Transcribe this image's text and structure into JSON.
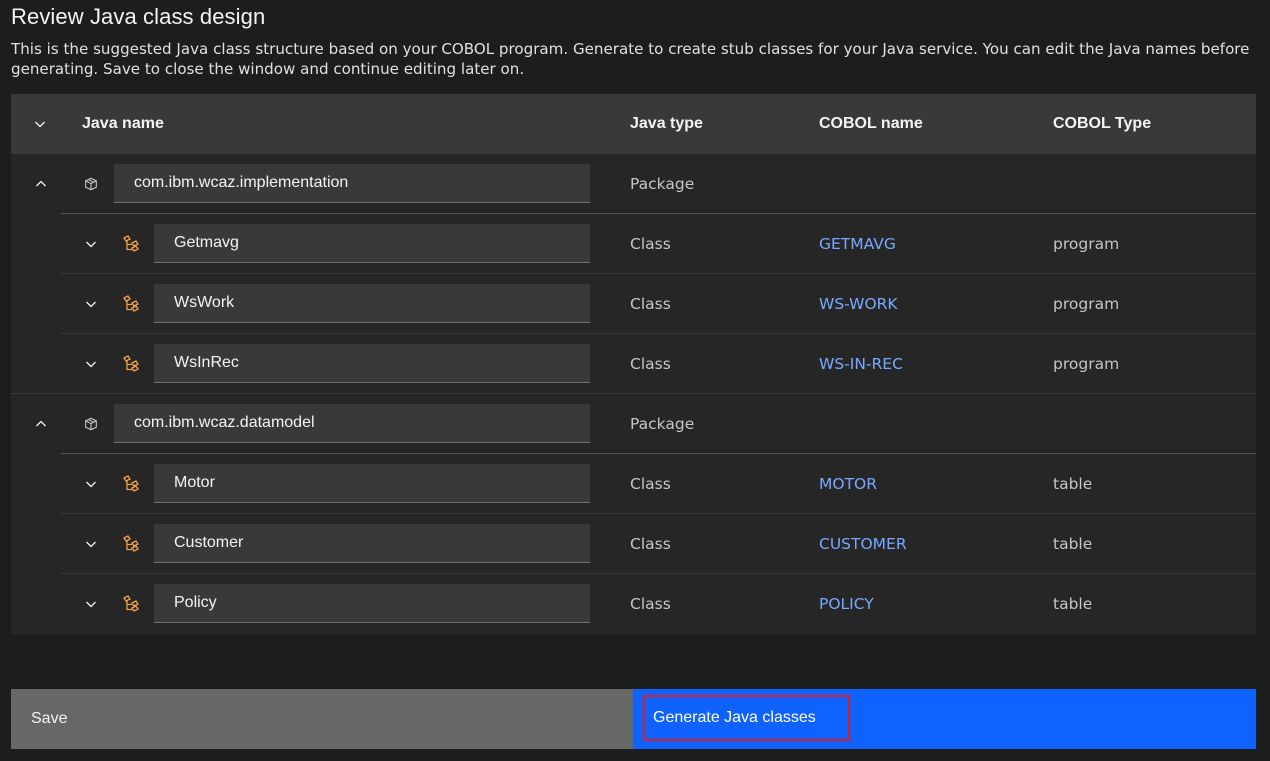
{
  "page": {
    "title": "Review Java class design",
    "description": "This is the suggested Java class structure based on your COBOL program. Generate to create stub classes for your Java service. You can edit the Java names before generating. Save to close the window and continue editing later on."
  },
  "table": {
    "headers": {
      "java_name": "Java name",
      "java_type": "Java type",
      "cobol_name": "COBOL name",
      "cobol_type": "COBOL Type"
    },
    "groups": [
      {
        "package": "com.ibm.wcaz.implementation",
        "type": "Package",
        "expanded": true,
        "classes": [
          {
            "name": "Getmavg",
            "type": "Class",
            "cobol_name": "GETMAVG",
            "cobol_type": "program"
          },
          {
            "name": "WsWork",
            "type": "Class",
            "cobol_name": "WS-WORK",
            "cobol_type": "program"
          },
          {
            "name": "WsInRec",
            "type": "Class",
            "cobol_name": "WS-IN-REC",
            "cobol_type": "program"
          }
        ]
      },
      {
        "package": "com.ibm.wcaz.datamodel",
        "type": "Package",
        "expanded": true,
        "classes": [
          {
            "name": "Motor",
            "type": "Class",
            "cobol_name": "MOTOR",
            "cobol_type": "table"
          },
          {
            "name": "Customer",
            "type": "Class",
            "cobol_name": "CUSTOMER",
            "cobol_type": "table"
          },
          {
            "name": "Policy",
            "type": "Class",
            "cobol_name": "POLICY",
            "cobol_type": "table"
          }
        ]
      }
    ]
  },
  "footer": {
    "save_label": "Save",
    "generate_label": "Generate Java classes"
  },
  "icons": {
    "header_expand": "chevron-down-icon",
    "package_expand": "chevron-up-icon",
    "class_expand": "chevron-down-icon",
    "package": "package-cube-icon",
    "class": "class-tree-icon"
  },
  "colors": {
    "link": "#78a9ff",
    "class_icon": "#f1a048",
    "primary_button": "#0f62fe",
    "secondary_button": "#666866",
    "focus_outline": "#da1e28"
  }
}
